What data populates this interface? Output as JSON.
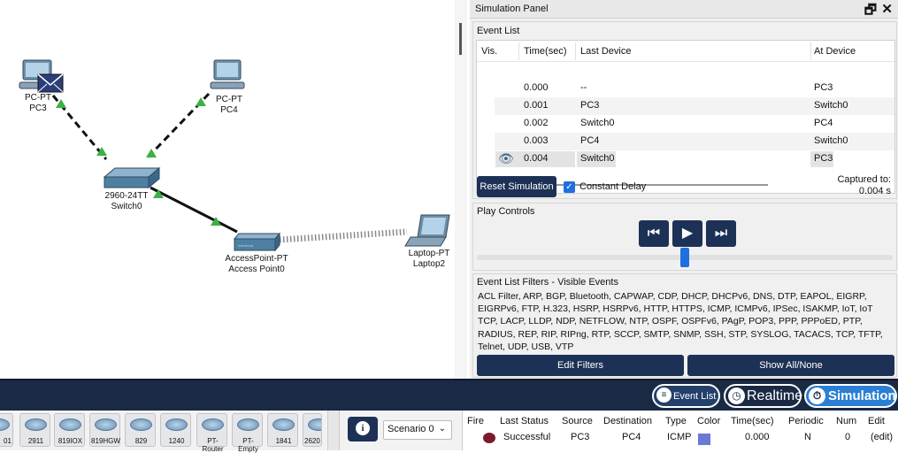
{
  "workspace": {
    "devices": [
      {
        "type": "PC-PT",
        "name": "PC3"
      },
      {
        "type": "PC-PT",
        "name": "PC4"
      },
      {
        "type": "2960-24TT",
        "name": "Switch0"
      },
      {
        "type": "AccessPoint-PT",
        "name": "Access Point0"
      },
      {
        "type": "Laptop-PT",
        "name": "Laptop2"
      }
    ]
  },
  "sim_panel": {
    "title": "Simulation Panel",
    "event_list": {
      "label": "Event List",
      "headers": [
        "Vis.",
        "Time(sec)",
        "Last Device",
        "At Device"
      ],
      "rows": [
        {
          "time": "0.000",
          "last": "--",
          "at": "PC3"
        },
        {
          "time": "0.001",
          "last": "PC3",
          "at": "Switch0"
        },
        {
          "time": "0.002",
          "last": "Switch0",
          "at": "PC4"
        },
        {
          "time": "0.003",
          "last": "PC4",
          "at": "Switch0"
        },
        {
          "time": "0.004",
          "last": "Switch0",
          "at": "PC3"
        }
      ]
    },
    "reset_label": "Reset Simulation",
    "constant_delay_label": "Constant Delay",
    "captured_label": "Captured to:",
    "captured_value": "0.004 s",
    "play_controls_label": "Play Controls",
    "play_position": 0.5,
    "filters": {
      "label": "Event List Filters - Visible Events",
      "text": "ACL Filter, ARP, BGP, Bluetooth, CAPWAP, CDP, DHCP, DHCPv6, DNS, DTP, EAPOL, EIGRP, EIGRPv6, FTP, H.323, HSRP, HSRPv6, HTTP, HTTPS, ICMP, ICMPv6, IPSec, ISAKMP, IoT, IoT TCP, LACP, LLDP, NDP, NETFLOW, NTP, OSPF, OSPFv6, PAgP, POP3, PPP, PPPoED, PTP, RADIUS, REP, RIP, RIPng, RTP, SCCP, SMTP, SNMP, SSH, STP, SYSLOG, TACACS, TCP, TFTP, Telnet, UDP, USB, VTP",
      "edit_label": "Edit Filters",
      "show_label": "Show All/None"
    }
  },
  "modebar": {
    "event_list": "Event List",
    "realtime": "Realtime",
    "simulation": "Simulation"
  },
  "tray": {
    "devices": [
      "01",
      "2911",
      "819IOX",
      "819HGW",
      "829",
      "1240",
      "PT-Router",
      "PT-Empty",
      "1841",
      "2620"
    ],
    "scenario": "Scenario 0",
    "pdu_headers": [
      "Fire",
      "Last Status",
      "Source",
      "Destination",
      "Type",
      "Color",
      "Time(sec)",
      "Periodic",
      "Num",
      "Edit"
    ],
    "pdu_row": {
      "status": "Successful",
      "source": "PC3",
      "destination": "PC4",
      "type": "ICMP",
      "time": "0.000",
      "periodic": "N",
      "num": "0",
      "edit": "(edit)"
    },
    "pdu_color": "#6b78d6"
  },
  "colors": {
    "navy": "#1d3156",
    "accent": "#1f6fe0",
    "modebar": "#1a2a44",
    "link_green": "#3cb043"
  }
}
